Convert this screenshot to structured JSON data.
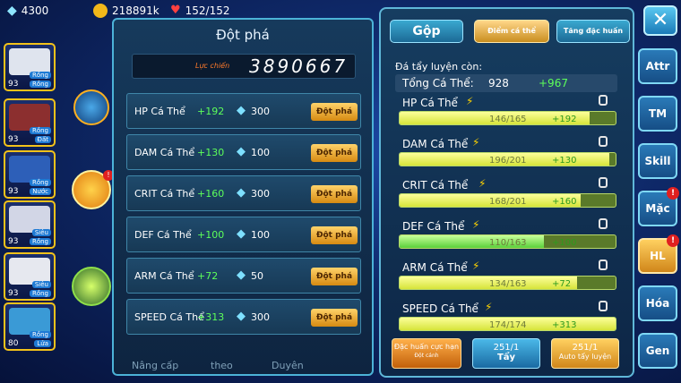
{
  "topbar": {
    "gems": "4300",
    "gold": "218891k",
    "energy": "152/152"
  },
  "team": [
    {
      "level": "93",
      "tags": [
        "Rồng",
        "Rồng"
      ],
      "art_color": "#dfe4ee"
    },
    {
      "level": "93",
      "tags": [
        "Rồng",
        "Đất"
      ],
      "art_color": "#8c2f2f"
    },
    {
      "level": "93",
      "tags": [
        "Rồng",
        "Nước"
      ],
      "art_color": "#2d5fb8"
    },
    {
      "level": "93",
      "tags": [
        "Siêu",
        "Rồng"
      ],
      "art_color": "#d2d6e6"
    },
    {
      "level": "93",
      "tags": [
        "Siêu",
        "Rồng"
      ],
      "art_color": "#e6e8ef"
    },
    {
      "level": "80",
      "tags": [
        "Rồng",
        "Lửa"
      ],
      "art_color": "#3a9ad6"
    }
  ],
  "breakthrough": {
    "title": "Đột phá",
    "power_label": "Lực chiến",
    "power_value": "3890667",
    "rows": [
      {
        "name": "HP Cá Thể",
        "bonus": "+192",
        "cost": "300",
        "btn": "Đột phá"
      },
      {
        "name": "DAM Cá Thể",
        "bonus": "+130",
        "cost": "100",
        "btn": "Đột phá"
      },
      {
        "name": "CRIT Cá Thể",
        "bonus": "+160",
        "cost": "300",
        "btn": "Đột phá"
      },
      {
        "name": "DEF Cá Thể",
        "bonus": "+100",
        "cost": "100",
        "btn": "Đột phá"
      },
      {
        "name": "ARM Cá Thể",
        "bonus": "+72",
        "cost": "50",
        "btn": "Đột phá"
      },
      {
        "name": "SPEED Cá Thể",
        "bonus": "+313",
        "cost": "300",
        "btn": "Đột phá"
      }
    ],
    "bottom_labels": [
      "Nâng cấp",
      "theo",
      "Duyên"
    ]
  },
  "panel": {
    "tabs": [
      "Gộp",
      "Điểm cá thể",
      "Tăng đặc huấn"
    ],
    "subtitle": "Đá tẩy luyện còn:",
    "total_label": "Tổng Cá Thể:",
    "total_value": "928",
    "total_bonus": "+967",
    "stats": [
      {
        "name": "HP Cá Thể",
        "value": "146/165",
        "bonus": "+192",
        "progress": 0.88
      },
      {
        "name": "DAM Cá Thể",
        "value": "196/201",
        "bonus": "+130",
        "progress": 0.97
      },
      {
        "name": "CRIT Cá Thể",
        "value": "168/201",
        "bonus": "+160",
        "progress": 0.84
      },
      {
        "name": "DEF Cá Thể",
        "value": "110/163",
        "bonus": "+100",
        "progress": 0.67
      },
      {
        "name": "ARM Cá Thể",
        "value": "134/163",
        "bonus": "+72",
        "progress": 0.82
      },
      {
        "name": "SPEED Cá Thể",
        "value": "174/174",
        "bonus": "+313",
        "progress": 1.0
      }
    ],
    "buttons": {
      "special_title": "Đặc huấn cực hạn",
      "special_sub": "Đột cánh",
      "wash_count": "251/1",
      "wash_label": "Tẩy",
      "auto_count": "251/1",
      "auto_label": "Auto tẩy luyện"
    }
  },
  "side_buttons": [
    "Attr",
    "TM",
    "Skill",
    "Mặc",
    "HL",
    "Hóa",
    "Gen"
  ],
  "side_badges": {
    "Mặc": "!",
    "HL": "!"
  },
  "colors": {
    "bonus_green": "#5dff5a",
    "gold_button": "#e8a020",
    "accent_cyan": "#5fb7d8"
  }
}
